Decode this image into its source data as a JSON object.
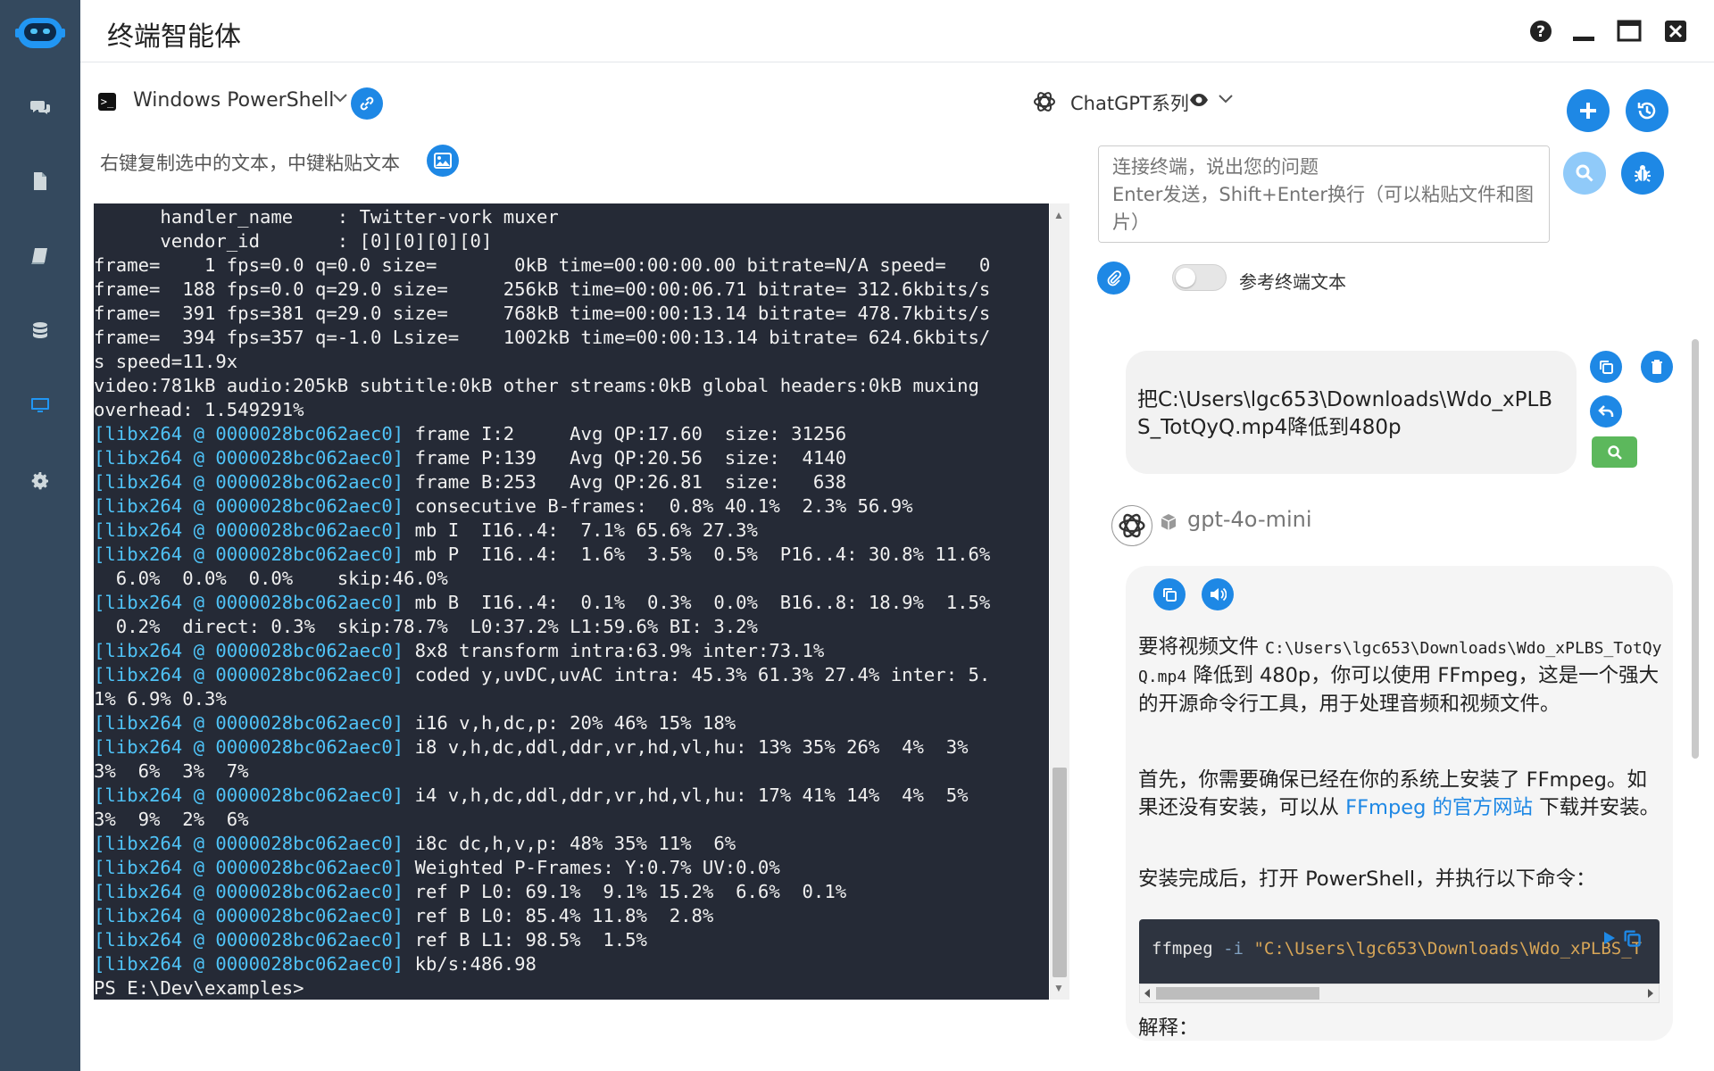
{
  "app": {
    "title": "终端智能体"
  },
  "sidebar": {
    "items": [
      {
        "name": "chat",
        "icon": "chat-bubbles-icon"
      },
      {
        "name": "document",
        "icon": "document-icon"
      },
      {
        "name": "book",
        "icon": "book-icon"
      },
      {
        "name": "database",
        "icon": "database-icon"
      },
      {
        "name": "terminal",
        "icon": "monitor-icon",
        "active": true
      },
      {
        "name": "settings",
        "icon": "gear-icon"
      }
    ]
  },
  "terminal": {
    "title": "Windows PowerShell",
    "hint": "右键复制选中的文本，中键粘贴文本",
    "prefix": "[libx264 @ 0000028bc062aec0]",
    "lines": [
      {
        "text": "      handler_name    : Twitter-vork muxer"
      },
      {
        "text": "      vendor_id       : [0][0][0][0]"
      },
      {
        "text": "frame=    1 fps=0.0 q=0.0 size=       0kB time=00:00:00.00 bitrate=N/A speed=   0"
      },
      {
        "text": "frame=  188 fps=0.0 q=29.0 size=     256kB time=00:00:06.71 bitrate= 312.6kbits/s"
      },
      {
        "text": "frame=  391 fps=381 q=29.0 size=     768kB time=00:00:13.14 bitrate= 478.7kbits/s"
      },
      {
        "text": "frame=  394 fps=357 q=-1.0 Lsize=    1002kB time=00:00:13.14 bitrate= 624.6kbits/"
      },
      {
        "text": "s speed=11.9x"
      },
      {
        "text": "video:781kB audio:205kB subtitle:0kB other streams:0kB global headers:0kB muxing"
      },
      {
        "text": "overhead: 1.549291%"
      },
      {
        "tag": true,
        "text": " frame I:2     Avg QP:17.60  size: 31256"
      },
      {
        "tag": true,
        "text": " frame P:139   Avg QP:20.56  size:  4140"
      },
      {
        "tag": true,
        "text": " frame B:253   Avg QP:26.81  size:   638"
      },
      {
        "tag": true,
        "text": " consecutive B-frames:  0.8% 40.1%  2.3% 56.9%"
      },
      {
        "tag": true,
        "text": " mb I  I16..4:  7.1% 65.6% 27.3%"
      },
      {
        "tag": true,
        "text": " mb P  I16..4:  1.6%  3.5%  0.5%  P16..4: 30.8% 11.6%"
      },
      {
        "text": "  6.0%  0.0%  0.0%    skip:46.0%"
      },
      {
        "tag": true,
        "text": " mb B  I16..4:  0.1%  0.3%  0.0%  B16..8: 18.9%  1.5%"
      },
      {
        "text": "  0.2%  direct: 0.3%  skip:78.7%  L0:37.2% L1:59.6% BI: 3.2%"
      },
      {
        "tag": true,
        "text": " 8x8 transform intra:63.9% inter:73.1%"
      },
      {
        "tag": true,
        "text": " coded y,uvDC,uvAC intra: 45.3% 61.3% 27.4% inter: 5."
      },
      {
        "text": "1% 6.9% 0.3%"
      },
      {
        "tag": true,
        "text": " i16 v,h,dc,p: 20% 46% 15% 18%"
      },
      {
        "tag": true,
        "text": " i8 v,h,dc,ddl,ddr,vr,hd,vl,hu: 13% 35% 26%  4%  3%"
      },
      {
        "text": "3%  6%  3%  7%"
      },
      {
        "tag": true,
        "text": " i4 v,h,dc,ddl,ddr,vr,hd,vl,hu: 17% 41% 14%  4%  5%"
      },
      {
        "text": "3%  9%  2%  6%"
      },
      {
        "tag": true,
        "text": " i8c dc,h,v,p: 48% 35% 11%  6%"
      },
      {
        "tag": true,
        "text": " Weighted P-Frames: Y:0.7% UV:0.0%"
      },
      {
        "tag": true,
        "text": " ref P L0: 69.1%  9.1% 15.2%  6.6%  0.1%"
      },
      {
        "tag": true,
        "text": " ref B L0: 85.4% 11.8%  2.8%"
      },
      {
        "tag": true,
        "text": " ref B L1: 98.5%  1.5%"
      },
      {
        "tag": true,
        "text": " kb/s:486.98"
      },
      {
        "text": "PS E:\\Dev\\examples>"
      }
    ]
  },
  "chat": {
    "model_group": "ChatGPT系列",
    "input_placeholder": "连接终端，说出您的问题\nEnter发送，Shift+Enter换行（可以粘贴文件和图片）",
    "reference_toggle_label": "参考终端文本",
    "reference_toggle_on": false,
    "user_message": "把C:\\Users\\lgc653\\Downloads\\Wdo_xPLBS_TotQyQ.mp4降低到480p",
    "bot_name": "gpt-4o-mini",
    "bot": {
      "p1_pre": "要将视频文件 ",
      "p1_code": "C:\\Users\\lgc653\\Downloads\\Wdo_xPLBS_TotQyQ.mp4",
      "p1_post": " 降低到 480p，你可以使用 FFmpeg，这是一个强大的开源命令行工具，用于处理音频和视频文件。",
      "p2_pre": "首先，你需要确保已经在你的系统上安装了 FFmpeg。如果还没有安装，可以从 ",
      "p2_link": "FFmpeg 的官方网站",
      "p2_post": " 下载并安装。",
      "p3": "安装完成后，打开 PowerShell，并执行以下命令：",
      "code_cmd": "ffmpeg",
      "code_flag": "-i",
      "code_arg": "\"C:\\Users\\lgc653\\Downloads\\Wdo_xPLBS_T",
      "partial": "解释："
    }
  },
  "colors": {
    "accent": "#1e88e5",
    "sidebar": "#34495e",
    "terminal_bg": "#252a36",
    "terminal_tag": "#4fc3f7",
    "success": "#5cb85c"
  }
}
